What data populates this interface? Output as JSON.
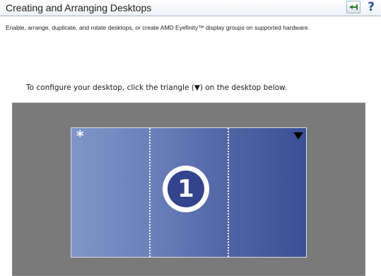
{
  "header": {
    "title": "Creating and Arranging Desktops",
    "pin_icon": "pin-icon",
    "help_label": "?"
  },
  "description": "Enable, arrange, duplicate, and rotate desktops, or create AMD Eyefinity™ display groups on supported hardware.",
  "instruction": "To configure your desktop, click the triangle (▼) on the desktop below.",
  "desktop": {
    "display_number": "1",
    "primary_marker": "*",
    "menu_icon": "triangle-down-icon",
    "colors": {
      "gradient_left": "#8096c8",
      "gradient_right": "#3a4f94",
      "badge": "#33448c",
      "area_background": "#7a7a7a"
    }
  }
}
